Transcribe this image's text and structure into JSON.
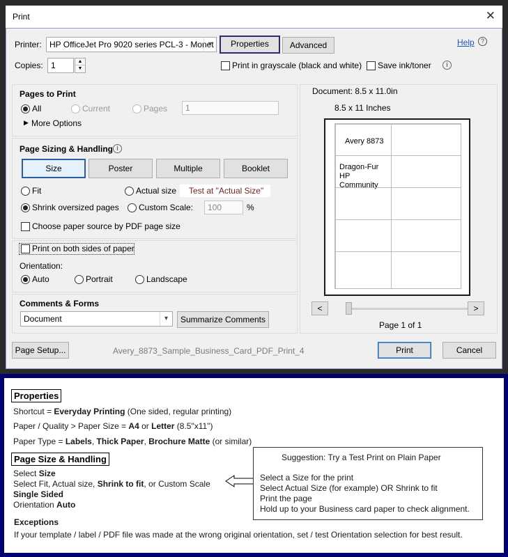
{
  "window": {
    "title": "Print"
  },
  "printer": {
    "label": "Printer:",
    "selected": "HP OfficeJet Pro 9020 series PCL-3 - Monet",
    "properties_label": "Properties",
    "advanced_label": "Advanced",
    "help_label": "Help",
    "copies_label": "Copies:",
    "copies_value": "1",
    "grayscale_label": "Print in grayscale (black and white)",
    "save_ink_label": "Save ink/toner"
  },
  "pages_to_print": {
    "title": "Pages to Print",
    "all": "All",
    "current": "Current",
    "pages": "Pages",
    "pages_value": "1",
    "more_options": "More Options"
  },
  "sizing": {
    "title": "Page Sizing & Handling",
    "tabs": [
      "Size",
      "Poster",
      "Multiple",
      "Booklet"
    ],
    "fit": "Fit",
    "actual_size": "Actual size",
    "test_note": "Test at \"Actual Size\"",
    "shrink": "Shrink oversized pages",
    "custom_scale": "Custom Scale:",
    "custom_scale_value": "100",
    "percent": "%",
    "paper_source": "Choose paper source by PDF page size"
  },
  "duplex": {
    "both_sides": "Print on both sides of paper",
    "orientation_label": "Orientation:",
    "auto": "Auto",
    "portrait": "Portrait",
    "landscape": "Landscape"
  },
  "comments": {
    "title": "Comments & Forms",
    "selected": "Document",
    "summarize_label": "Summarize Comments"
  },
  "preview": {
    "document_size": "Document: 8.5 x 11.0in",
    "paper_size": "8.5 x 11 Inches",
    "label1": "Avery 8873",
    "label2_line1": "Dragon-Fur",
    "label2_line2": "HP Community",
    "prev": "<",
    "next": ">",
    "page_of": "Page 1 of 1"
  },
  "footer": {
    "page_setup": "Page Setup...",
    "filename": "Avery_8873_Sample_Business_Card_PDF_Print_4",
    "print": "Print",
    "cancel": "Cancel"
  },
  "notes": {
    "properties_heading": "Properties",
    "shortcut_pre": "Shortcut = ",
    "shortcut_bold": "Everyday Printing",
    "shortcut_post": " (One sided, regular printing)",
    "paper_pre": "Paper / Quality > Paper Size = ",
    "paper_a4": "A4",
    "paper_or": " or ",
    "paper_letter": "Letter",
    "paper_post": " (8.5\"x11\")",
    "type_pre": "Paper Type = ",
    "type_labels": "Labels",
    "type_c1": ", ",
    "type_thick": "Thick Paper",
    "type_c2": ", ",
    "type_brochure": "Brochure Matte",
    "type_post": " (or similar)",
    "size_heading": "Page Size & Handling",
    "select_pre": "Select ",
    "select_size": "Size",
    "fit_pre": "Select Fit, Actual size, ",
    "fit_bold": "Shrink to fit",
    "fit_post": ", or Custom Scale",
    "single_sided": "Single Sided",
    "orientation_pre": "Orientation ",
    "orientation_bold": "Auto",
    "exceptions_heading": "Exceptions",
    "exceptions_text": "If your template / label / PDF file was made at the wrong original orientation, set / test Orientation selection for best result.",
    "suggestion_title": "Suggestion:  Try a Test Print on Plain Paper",
    "suggestion_1": "Select a Size for the print",
    "suggestion_2": "Select Actual Size (for example) OR Shrink to fit",
    "suggestion_3": "Print the page",
    "suggestion_4": "Hold up to your Business card paper to check alignment."
  }
}
